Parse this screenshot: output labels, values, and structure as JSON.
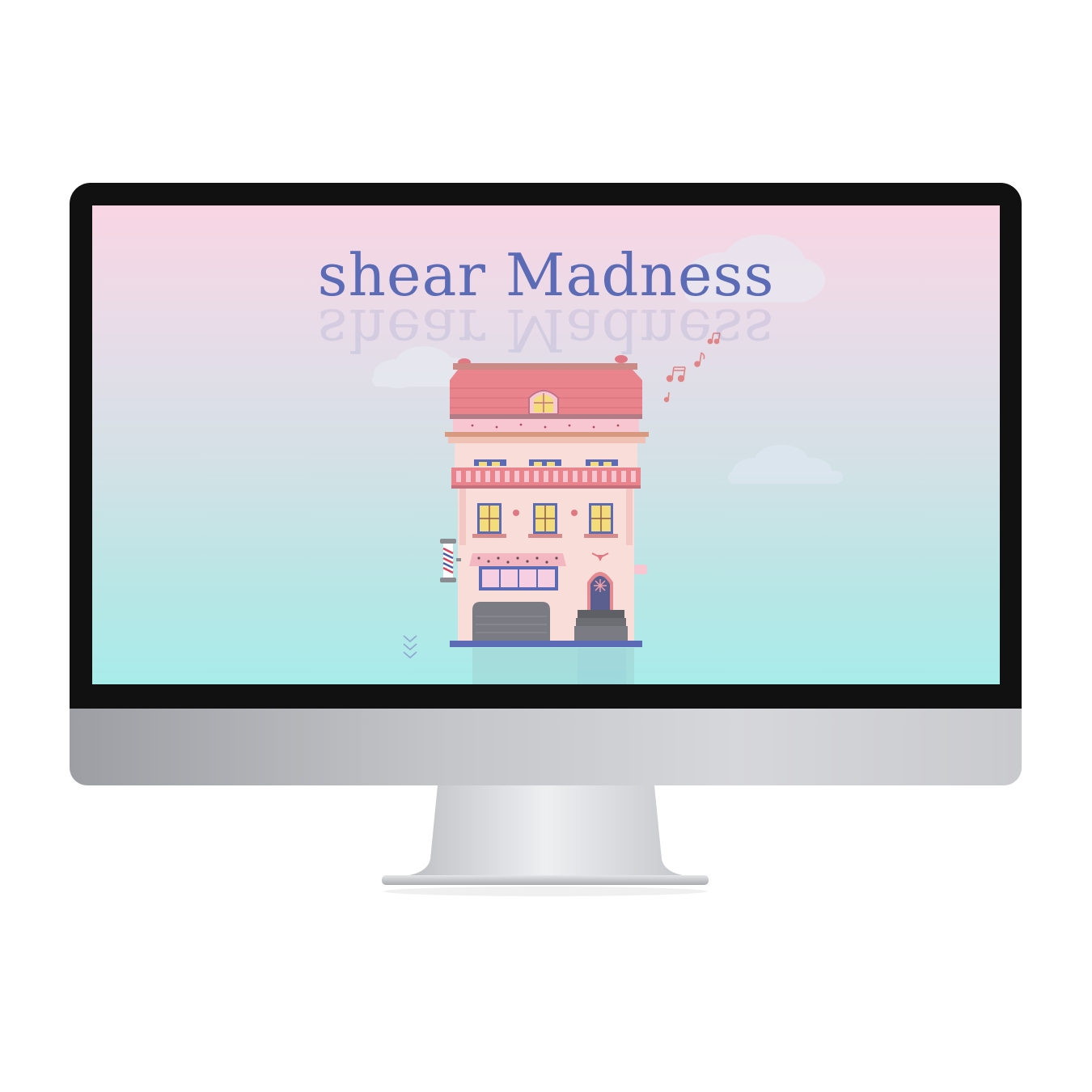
{
  "site": {
    "title": "shear Madness"
  },
  "colors": {
    "title": "#5b6bb5",
    "sky_top": "#f9d5e3",
    "sky_bottom": "#a8ecea",
    "roof": "#e9848d",
    "facade": "#f8ddd9",
    "door": "#5b5f8f"
  },
  "icons": {
    "music_notes": "music-notes-icon",
    "scroll_down": "chevron-down-icon",
    "barber_pole": "barber-pole-icon"
  }
}
